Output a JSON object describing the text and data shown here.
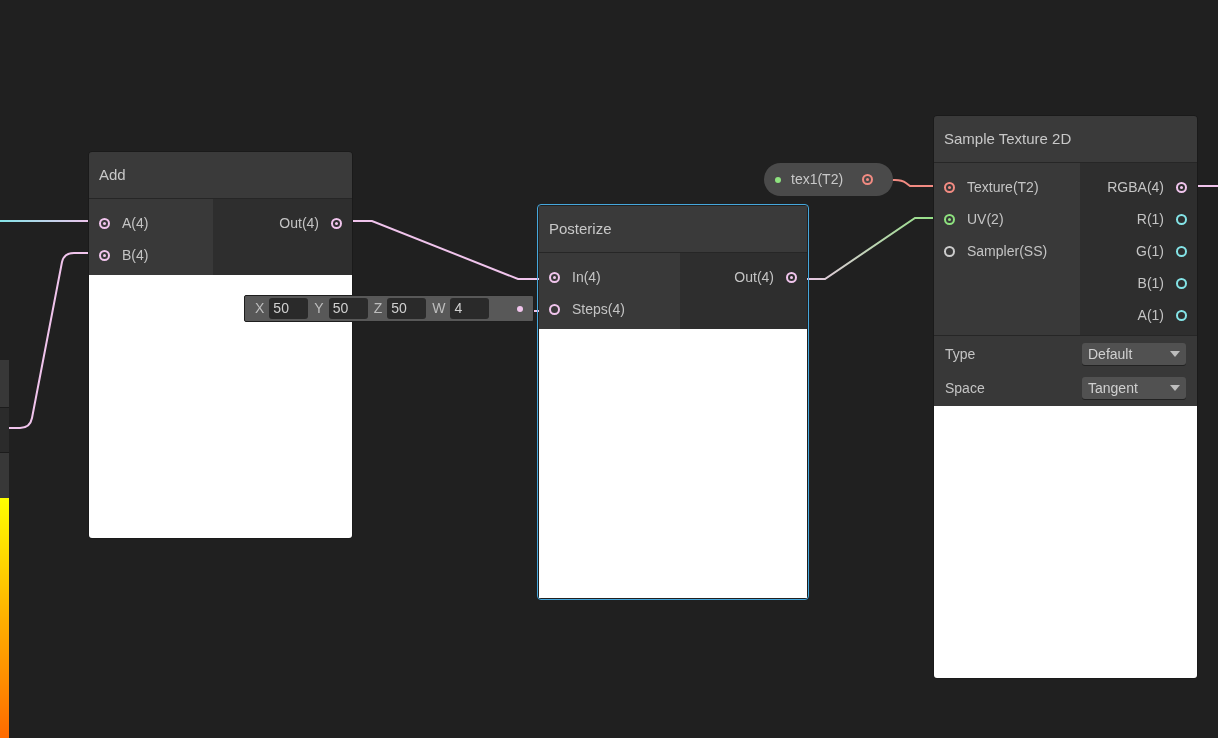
{
  "nodes": [
    {
      "title": "Add",
      "selected": false,
      "inputs": [
        {
          "label": "A(4)",
          "connected": true,
          "color": "#f0c4ec"
        },
        {
          "label": "B(4)",
          "connected": true,
          "color": "#f0c4ec"
        }
      ],
      "outputs": [
        {
          "label": "Out(4)",
          "connected": true,
          "color": "#f0c4ec"
        }
      ]
    },
    {
      "title": "Posterize",
      "selected": true,
      "inputs": [
        {
          "label": "In(4)",
          "connected": true,
          "color": "#f0c4ec"
        },
        {
          "label": "Steps(4)",
          "connected": false,
          "color": "#f0c4ec"
        }
      ],
      "outputs": [
        {
          "label": "Out(4)",
          "connected": true,
          "color": "#f0c4ec"
        }
      ]
    },
    {
      "title": "Sample Texture 2D",
      "selected": false,
      "inputs": [
        {
          "label": "Texture(T2)",
          "connected": true,
          "color": "#f28b82"
        },
        {
          "label": "UV(2)",
          "connected": true,
          "color": "#8ee27f"
        },
        {
          "label": "Sampler(SS)",
          "connected": false,
          "color": "#cccccc"
        }
      ],
      "outputs": [
        {
          "label": "RGBA(4)",
          "connected": true,
          "color": "#f0c4ec"
        },
        {
          "label": "R(1)",
          "connected": false,
          "color": "#84e4e7"
        },
        {
          "label": "G(1)",
          "connected": false,
          "color": "#84e4e7"
        },
        {
          "label": "B(1)",
          "connected": false,
          "color": "#84e4e7"
        },
        {
          "label": "A(1)",
          "connected": false,
          "color": "#84e4e7"
        }
      ],
      "controls": [
        {
          "label": "Type",
          "value": "Default"
        },
        {
          "label": "Space",
          "value": "Tangent"
        }
      ]
    }
  ],
  "property": {
    "label": "tex1(T2)",
    "color": "#f28b82"
  },
  "inline_field": {
    "components": [
      {
        "label": "X",
        "value": "50"
      },
      {
        "label": "Y",
        "value": "50"
      },
      {
        "label": "Z",
        "value": "50"
      },
      {
        "label": "W",
        "value": "4"
      }
    ]
  }
}
